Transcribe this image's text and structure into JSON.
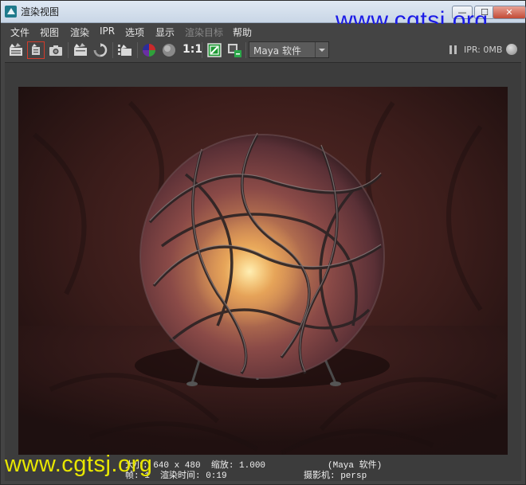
{
  "window": {
    "title": "渲染视图",
    "minimize_glyph": "—",
    "maximize_glyph": "☐",
    "close_glyph": "✕"
  },
  "watermark": {
    "text": "www.cgtsj.org"
  },
  "menu": {
    "items": [
      "文件",
      "视图",
      "渲染",
      "IPR",
      "选项",
      "显示",
      "渲染目标",
      "帮助"
    ]
  },
  "toolbar": {
    "ratio_label": "1:1",
    "renderer_value": "Maya 软件",
    "ipr_memory": "IPR: 0MB",
    "icons": [
      "redo-render-icon",
      "render-region-icon",
      "snapshot-icon",
      "ipr-render-icon",
      "refresh-ipr-icon",
      "render-sequence-icon",
      "rgb-channels-icon",
      "alpha-channel-icon",
      "real-size-icon",
      "keep-image-icon",
      "remove-image-icon"
    ]
  },
  "render_info": {
    "line1_left": "大小: 640 x 480  缩放: 1.000",
    "line1_right": "(Maya 软件)",
    "line2_left": "帧: 1  渲染时间: 0:19",
    "line2_right": "摄影机: persp"
  },
  "colors": {
    "window_bg": "#444444",
    "menu_text": "#e6e6e6",
    "watermark_top": "#1b1be6",
    "watermark_bottom": "#e8e600"
  }
}
